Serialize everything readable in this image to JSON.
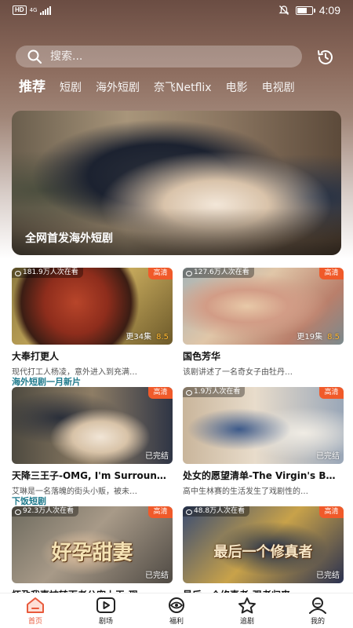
{
  "status_bar": {
    "hd": "HD",
    "net": "4G",
    "time": "4:09"
  },
  "search": {
    "placeholder": "搜索..."
  },
  "tabs": [
    {
      "label": "推荐",
      "active": true
    },
    {
      "label": "短剧"
    },
    {
      "label": "海外短剧"
    },
    {
      "label": "奈飞Netflix"
    },
    {
      "label": "电影"
    },
    {
      "label": "电视剧"
    }
  ],
  "banner": {
    "title": "全网首发海外短剧"
  },
  "sections": [
    {
      "label": "海外短剧一月新片"
    },
    {
      "label": "下饭短剧"
    }
  ],
  "cards": [
    {
      "viewers": "181.9万人次在看",
      "badge": "高清",
      "episodes": "更34集",
      "score": "8.5",
      "title": "大奉打更人",
      "desc": "现代打工人杨凌，意外进入到充满…"
    },
    {
      "viewers": "127.6万人次在看",
      "badge": "高清",
      "episodes": "更19集",
      "score": "8.5",
      "title": "国色芳华",
      "desc": "该剧讲述了一名奇女子由牡丹…"
    },
    {
      "viewers": "",
      "badge": "高清",
      "episodes": "已完结",
      "score": "",
      "title": "天降三王子-OMG, I'm Surroun…",
      "desc": "艾琳是一名落魄的街头小贩，被未…"
    },
    {
      "viewers": "1.9万人次在看",
      "badge": "高清",
      "episodes": "已完结",
      "score": "",
      "title": "处女的愿望清单-The Virgin's B…",
      "desc": "高中生林赛的生活发生了戏剧性的…"
    },
    {
      "viewers": "92.3万人次在看",
      "badge": "高清",
      "episodes": "已完结",
      "score": "",
      "title": "怀孕我妻被转百老公宠上天-现…",
      "desc": "",
      "overlay": "好孕甜妻"
    },
    {
      "viewers": "48.8万人次在看",
      "badge": "高清",
      "episodes": "已完结",
      "score": "",
      "title": "最后一个修真者-强者归来",
      "desc": "",
      "overlay": "最后一个修真者"
    }
  ],
  "bottom_nav": [
    {
      "label": "首页",
      "icon": "home-icon",
      "active": true
    },
    {
      "label": "剧场",
      "icon": "play-icon"
    },
    {
      "label": "福利",
      "icon": "eye-icon"
    },
    {
      "label": "追剧",
      "icon": "star-icon"
    },
    {
      "label": "我的",
      "icon": "profile-icon"
    }
  ],
  "colors": {
    "accent": "#e85a3c",
    "badge": "#f05a2a",
    "section": "#1f7a8c",
    "score": "#ffb62e"
  }
}
